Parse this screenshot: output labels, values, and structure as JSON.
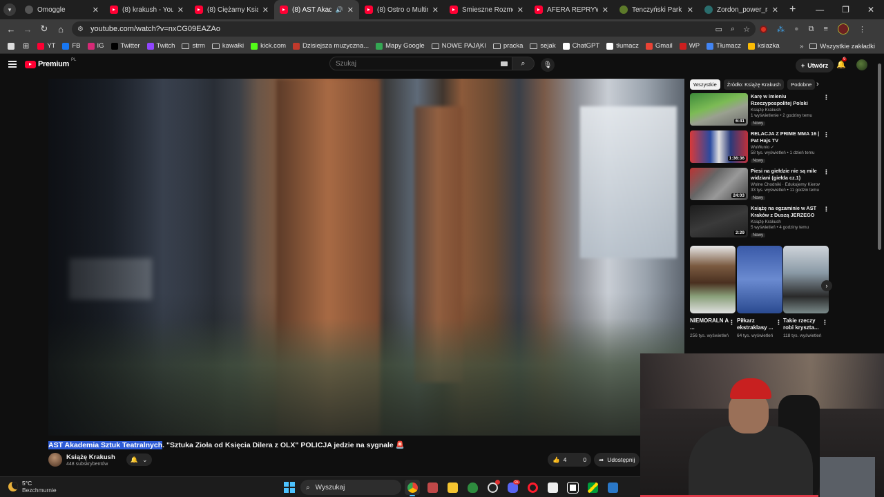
{
  "browser": {
    "tabs": [
      {
        "label": "Omoggle",
        "icon": "omoggle-favicon",
        "active": false
      },
      {
        "label": "(8) krakush - YouTube",
        "icon": "youtube-favicon",
        "active": false
      },
      {
        "label": "(8) Ciężarny Ksiądz E",
        "icon": "youtube-favicon",
        "active": false
      },
      {
        "label": "(8) AST Akademia",
        "icon": "youtube-favicon",
        "active": true
      },
      {
        "label": "(8) Ostro o Multim #",
        "icon": "youtube-favicon",
        "active": false
      },
      {
        "label": "Śmieszne Rozmowy",
        "icon": "youtube-favicon",
        "active": false
      },
      {
        "label": "AFERA REPRYWATYZ",
        "icon": "youtube-favicon",
        "active": false
      },
      {
        "label": "Tenczyński Park Kraj",
        "icon": "park-favicon",
        "active": false
      },
      {
        "label": "Zordon_power_rang",
        "icon": "zordon-favicon",
        "active": false
      }
    ],
    "url": "youtube.com/watch?v=nxCG09EAZAo",
    "bookmarks": [
      {
        "label": "YT",
        "icon": "youtube-icon",
        "color": "#ff0033"
      },
      {
        "label": "FB",
        "icon": "facebook-icon",
        "color": "#1877f2"
      },
      {
        "label": "IG",
        "icon": "instagram-icon",
        "color": "#d62976"
      },
      {
        "label": "Twitter",
        "icon": "x-icon",
        "color": "#000000"
      },
      {
        "label": "Twitch",
        "icon": "twitch-icon",
        "color": "#9146ff"
      },
      {
        "label": "strm",
        "icon": "folder-icon",
        "color": ""
      },
      {
        "label": "kawałki",
        "icon": "folder-icon",
        "color": ""
      },
      {
        "label": "kick.com",
        "icon": "kick-icon",
        "color": "#53fc18"
      },
      {
        "label": "Dzisiejsza muzyczna...",
        "icon": "music-icon",
        "color": "#c0392b"
      },
      {
        "label": "Mapy Google",
        "icon": "maps-icon",
        "color": "#34a853"
      },
      {
        "label": "NOWE PAJĄKI",
        "icon": "folder-icon",
        "color": ""
      },
      {
        "label": "pracka",
        "icon": "folder-icon",
        "color": ""
      },
      {
        "label": "sejak",
        "icon": "folder-icon",
        "color": ""
      },
      {
        "label": "ChatGPT",
        "icon": "chatgpt-icon",
        "color": "#ffffff"
      },
      {
        "label": "tłumacz",
        "icon": "translate-icon",
        "color": "#ffffff"
      },
      {
        "label": "Gmail",
        "icon": "gmail-icon",
        "color": "#ea4335"
      },
      {
        "label": "WP",
        "icon": "wp-icon",
        "color": "#cc1f1f"
      },
      {
        "label": "Tłumacz",
        "icon": "translate-icon",
        "color": "#4285f4"
      },
      {
        "label": "ksiazka",
        "icon": "apps-icon",
        "color": "#fbbc05"
      }
    ],
    "all_bookmarks_label": "Wszystkie zakładki"
  },
  "youtube": {
    "logo_text": "Premium",
    "logo_country": "PL",
    "search_placeholder": "Szukaj",
    "create_label": "Utwórz",
    "notifications_count": "9",
    "video": {
      "title_highlighted": "AST Akademia Sztuk Teatralnych",
      "title_rest": ". \"Sztuka Zioła od Księcia Dilera z OLX\" POLICJA jedzie na sygnale 🚨",
      "channel": "Książę Krakush",
      "subscribers": "448 subskrybentów",
      "likes": "4",
      "dislikes": "0",
      "share_label": "Udostępnij"
    },
    "chips": [
      {
        "label": "Wszystkie",
        "selected": true
      },
      {
        "label": "Źródło: Książę Krakush",
        "selected": false
      },
      {
        "label": "Podobne",
        "selected": false
      }
    ],
    "recommendations": [
      {
        "title": "Karę w imieniu Rzeczypospolitej Polski odbywam na murku za ...",
        "channel": "Książę Krakush",
        "meta": "1 wyświetlenie • 2 godziny temu",
        "badge": "Nowy",
        "duration": "6:41"
      },
      {
        "title": "RELACJA Z PRIME MMA 16 | Pat Hajs TV",
        "channel": "WuWunio ✓",
        "meta": "58 tys. wyświetleń • 1 dzień temu",
        "badge": "Nowy",
        "duration": "1:36:36"
      },
      {
        "title": "Piesi na giełdzie nie są mile widziani (giełda cz.1)",
        "channel": "Wolne Chodniki · Edukujemy Kierowców",
        "meta": "33 tys. wyświetleń • 11 godzin temu",
        "badge": "Nowy",
        "duration": "24:03"
      },
      {
        "title": "Książę na egzaminie w AST Kraków z Duszą JERZEGO ...",
        "channel": "Książę Krakush",
        "meta": "5 wyświetleń • 4 godziny temu",
        "badge": "Nowy",
        "duration": "2:29"
      }
    ],
    "shorts": [
      {
        "title": "NIEMORALN A ...",
        "views": "256 tys. wyświetleń"
      },
      {
        "title": "Piłkarz ekstraklasy ...",
        "views": "64 tys. wyświetleń"
      },
      {
        "title": "Takie rzeczy robi kryszta...",
        "views": "118 tys. wyświetleń"
      }
    ]
  },
  "taskbar": {
    "temperature": "5°C",
    "weather": "Bezchmurnie",
    "search_label": "Wyszukaj",
    "discord_badge": "9+"
  }
}
